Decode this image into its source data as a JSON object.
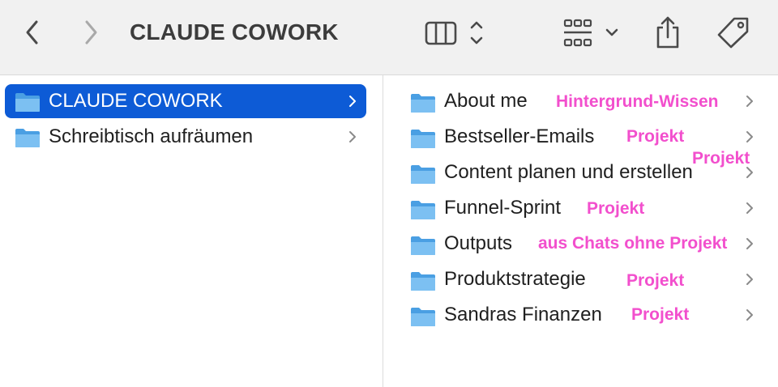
{
  "window": {
    "title": "CLAUDE COWORK"
  },
  "toolbar": {
    "back_icon": "chevron-left-icon",
    "forward_icon": "chevron-right-icon",
    "view_icon": "column-view-icon",
    "group_icon": "grid-group-icon",
    "share_icon": "share-icon",
    "tag_icon": "tag-icon"
  },
  "colors": {
    "selection": "#0d5bd6",
    "folder": "#5aaee8",
    "annotation": "#f24fcd"
  },
  "left_column": {
    "items": [
      {
        "label": "CLAUDE COWORK",
        "selected": true
      },
      {
        "label": "Schreibtisch aufräumen",
        "selected": false
      }
    ]
  },
  "right_column": {
    "items": [
      {
        "label": "About me"
      },
      {
        "label": "Bestseller-Emails"
      },
      {
        "label": "Content planen und erstellen"
      },
      {
        "label": "Funnel-Sprint"
      },
      {
        "label": "Outputs"
      },
      {
        "label": "Produktstrategie"
      },
      {
        "label": "Sandras Finanzen"
      }
    ]
  },
  "annotations": [
    "Hintergrund-Wissen",
    "Projekt",
    "Projekt",
    "Projekt",
    "aus Chats ohne Projekt",
    "Projekt",
    "Projekt"
  ]
}
